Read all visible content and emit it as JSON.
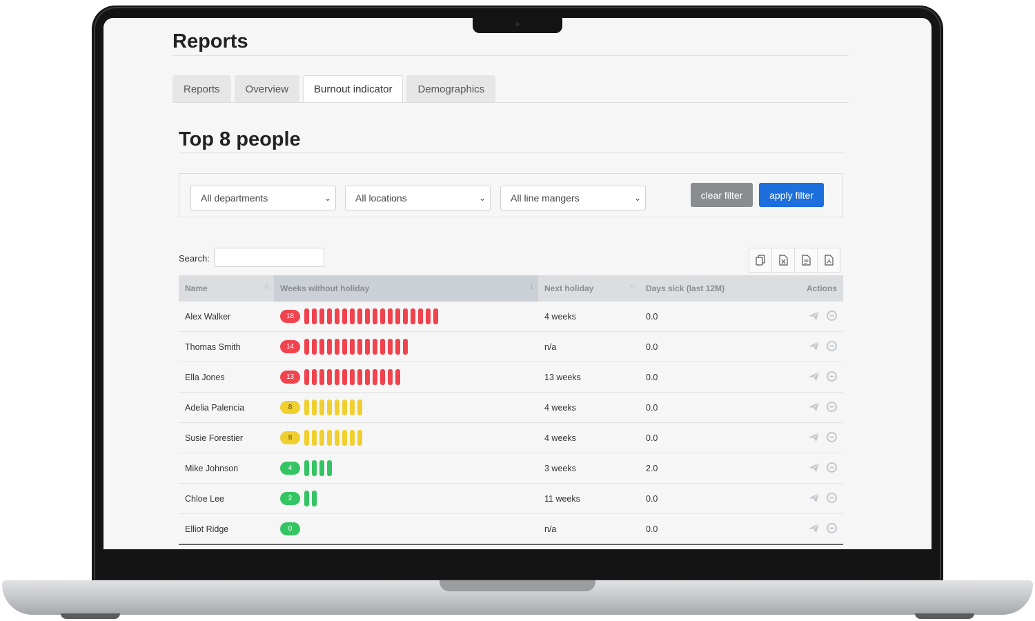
{
  "page": {
    "title": "Reports"
  },
  "tabs": [
    {
      "label": "Reports",
      "active": false
    },
    {
      "label": "Overview",
      "active": false
    },
    {
      "label": "Burnout indicator",
      "active": true
    },
    {
      "label": "Demographics",
      "active": false
    }
  ],
  "section": {
    "title": "Top 8 people"
  },
  "filters": {
    "department": "All departments",
    "location": "All locations",
    "line_manager": "All line mangers",
    "clear_label": "clear filter",
    "apply_label": "apply filter"
  },
  "search": {
    "label": "Search:",
    "value": ""
  },
  "export_icons": [
    "copy-icon",
    "excel-icon",
    "csv-icon",
    "pdf-icon"
  ],
  "table": {
    "headers": {
      "name": "Name",
      "weeks": "Weeks without holiday",
      "next_holiday": "Next holiday",
      "days_sick": "Days sick (last 12M)",
      "actions": "Actions"
    },
    "rows": [
      {
        "name": "Alex Walker",
        "weeks": 18,
        "level": "high",
        "next_holiday": "4 weeks",
        "days_sick": "0.0"
      },
      {
        "name": "Thomas Smith",
        "weeks": 14,
        "level": "high",
        "next_holiday": "n/a",
        "days_sick": "0.0"
      },
      {
        "name": "Ella Jones",
        "weeks": 13,
        "level": "high",
        "next_holiday": "13 weeks",
        "days_sick": "0.0"
      },
      {
        "name": "Adelia Palencia",
        "weeks": 8,
        "level": "medium",
        "next_holiday": "4 weeks",
        "days_sick": "0.0"
      },
      {
        "name": "Susie Forestier",
        "weeks": 8,
        "level": "medium",
        "next_holiday": "4 weeks",
        "days_sick": "0.0"
      },
      {
        "name": "Mike Johnson",
        "weeks": 4,
        "level": "low",
        "next_holiday": "3 weeks",
        "days_sick": "2.0"
      },
      {
        "name": "Chloe Lee",
        "weeks": 2,
        "level": "low",
        "next_holiday": "11 weeks",
        "days_sick": "0.0"
      },
      {
        "name": "Elliot Ridge",
        "weeks": 0,
        "level": "low",
        "next_holiday": "n/a",
        "days_sick": "0.0"
      }
    ],
    "row_action_icons": [
      "send-icon",
      "minus-circle-icon"
    ]
  },
  "colors": {
    "high": "#f0434e",
    "medium": "#f0cf2e",
    "low": "#35c463",
    "badge_text_high": "#ffffff",
    "badge_text_medium": "#5a4a00",
    "badge_text_low": "#ffffff",
    "primary": "#1c6fdd",
    "secondary": "#8a8d90"
  }
}
